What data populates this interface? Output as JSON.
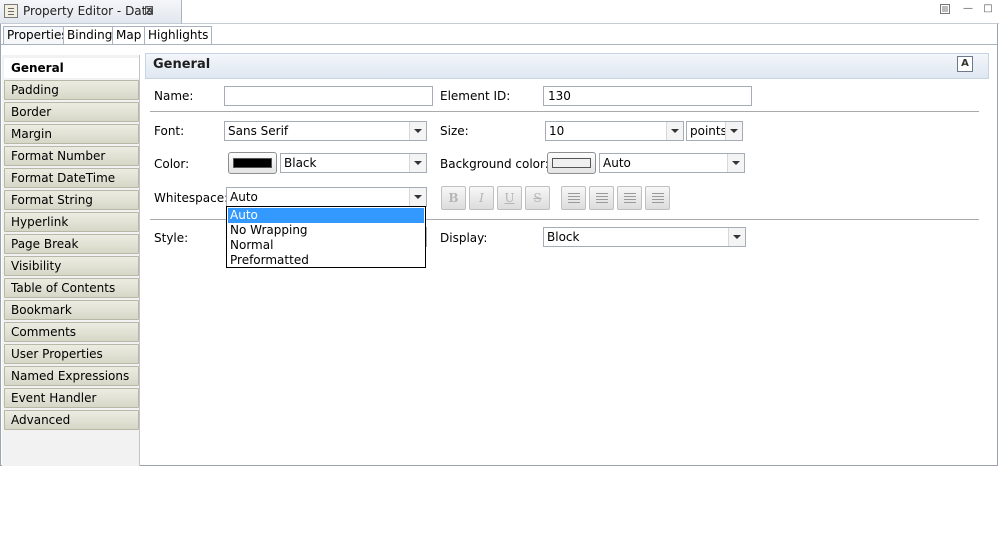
{
  "window": {
    "title": "Property Editor - Data",
    "close_glyph": "⊠",
    "minimize_glyph": "—",
    "maximize_glyph": "□"
  },
  "tabs": [
    {
      "label": "Properties",
      "active": true
    },
    {
      "label": "Binding",
      "active": false
    },
    {
      "label": "Map",
      "active": false
    },
    {
      "label": "Highlights",
      "active": false
    }
  ],
  "categories": [
    "General",
    "Padding",
    "Border",
    "Margin",
    "Format Number",
    "Format DateTime",
    "Format String",
    "Hyperlink",
    "Page Break",
    "Visibility",
    "Table of Contents",
    "Bookmark",
    "Comments",
    "User Properties",
    "Named Expressions",
    "Event Handler",
    "Advanced"
  ],
  "selected_category": "General",
  "section": {
    "title": "General",
    "icon": "edit-style-icon",
    "icon_glyph": "A"
  },
  "form": {
    "name_label": "Name:",
    "name_value": "",
    "element_id_label": "Element ID:",
    "element_id_value": "130",
    "font_label": "Font:",
    "font_value": "Sans Serif",
    "size_label": "Size:",
    "size_value": "10",
    "size_unit": "points",
    "color_label": "Color:",
    "color_value": "Black",
    "color_swatch": "#000000",
    "bgcolor_label": "Background color:",
    "bgcolor_value": "Auto",
    "bgcolor_swatch": "#f0f0f0",
    "whitespace_label": "Whitespace:",
    "whitespace_value": "Auto",
    "style_label": "Style:",
    "display_label": "Display:",
    "display_value": "Block",
    "bold_glyph": "B",
    "italic_glyph": "I",
    "underline_glyph": "U",
    "strike_glyph": "S"
  },
  "whitespace_options": [
    {
      "label": "Auto",
      "selected": true
    },
    {
      "label": "No Wrapping",
      "selected": false
    },
    {
      "label": "Normal",
      "selected": false
    },
    {
      "label": "Preformatted",
      "selected": false
    }
  ],
  "colors": {
    "selection": "#3399ff",
    "section_header": "#dfe7f1"
  }
}
